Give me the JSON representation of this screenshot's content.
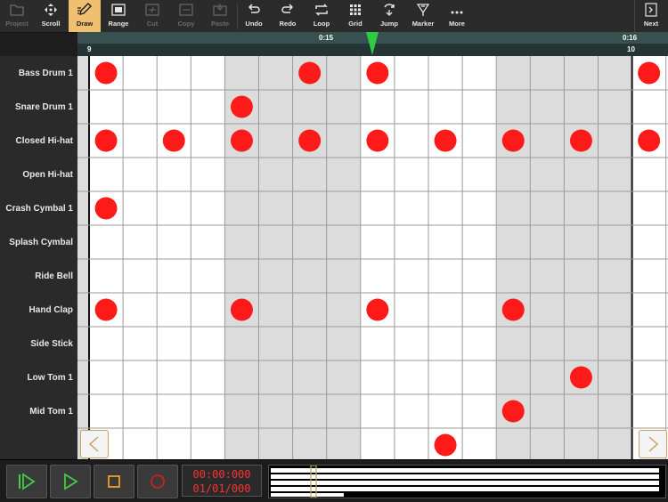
{
  "toolbar": {
    "project": "Project",
    "scroll": "Scroll",
    "draw": "Draw",
    "range": "Range",
    "cut": "Cut",
    "copy": "Copy",
    "paste": "Paste",
    "undo": "Undo",
    "redo": "Redo",
    "loop": "Loop",
    "grid": "Grid",
    "jump": "Jump",
    "marker": "Marker",
    "more": "More",
    "next": "Next"
  },
  "ruler": {
    "time_a": "0:15",
    "time_b": "0:16",
    "bar_a": "9",
    "bar_b": "10"
  },
  "tracks": [
    "Bass Drum 1",
    "Snare Drum 1",
    "Closed Hi-hat",
    "Open Hi-hat",
    "Crash Cymbal 1",
    "Splash Cymbal",
    "Ride Bell",
    "Hand Clap",
    "Side Stick",
    "Low Tom 1",
    "Mid Tom 1",
    ""
  ],
  "steps_visible": 17,
  "notes": [
    {
      "row": 0,
      "step": 0
    },
    {
      "row": 0,
      "step": 6
    },
    {
      "row": 0,
      "step": 8
    },
    {
      "row": 0,
      "step": 16
    },
    {
      "row": 1,
      "step": 4
    },
    {
      "row": 2,
      "step": 0
    },
    {
      "row": 2,
      "step": 2
    },
    {
      "row": 2,
      "step": 4
    },
    {
      "row": 2,
      "step": 6
    },
    {
      "row": 2,
      "step": 8
    },
    {
      "row": 2,
      "step": 10
    },
    {
      "row": 2,
      "step": 12
    },
    {
      "row": 2,
      "step": 14
    },
    {
      "row": 2,
      "step": 16
    },
    {
      "row": 4,
      "step": 0
    },
    {
      "row": 7,
      "step": 0
    },
    {
      "row": 7,
      "step": 4
    },
    {
      "row": 7,
      "step": 8
    },
    {
      "row": 7,
      "step": 12
    },
    {
      "row": 9,
      "step": 14
    },
    {
      "row": 10,
      "step": 12
    },
    {
      "row": 11,
      "step": 10
    }
  ],
  "transport": {
    "time": "00:00:000",
    "position": "01/01/000"
  },
  "colors": {
    "note": "#ff1a1a",
    "active_tool": "#f0c070",
    "playhead": "#2ecc40",
    "counter_text": "#ff3030",
    "transport_icon": "#44cc44"
  }
}
